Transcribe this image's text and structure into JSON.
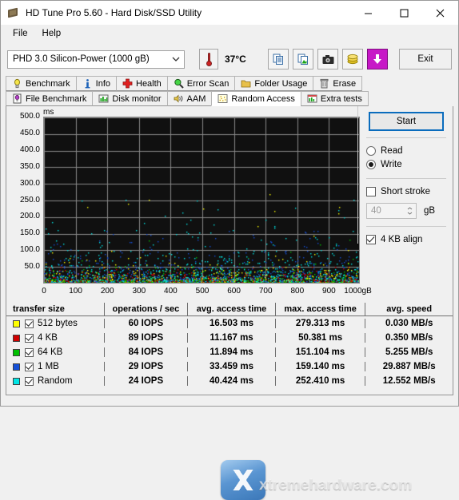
{
  "window": {
    "title": "HD Tune Pro 5.60 - Hard Disk/SSD Utility",
    "minimize_label": "Minimize",
    "maximize_label": "Maximize",
    "close_label": "Close"
  },
  "menu": {
    "items": [
      {
        "label": "File"
      },
      {
        "label": "Help"
      }
    ]
  },
  "toolbar": {
    "drive": "PHD 3.0 Silicon-Power (1000 gB)",
    "temperature": "37°C",
    "buttons": [
      {
        "name": "copy-button",
        "label": "Copy"
      },
      {
        "name": "copy-image-button",
        "label": "Copy image"
      },
      {
        "name": "screenshot-button",
        "label": "Screenshot"
      },
      {
        "name": "coins-button",
        "label": "Register"
      },
      {
        "name": "save-button",
        "label": "Save"
      }
    ],
    "exit_label": "Exit"
  },
  "tabs": {
    "row1": [
      {
        "label": "Benchmark",
        "icon": "lightbulb-icon",
        "active": false
      },
      {
        "label": "Info",
        "icon": "info-icon",
        "active": false
      },
      {
        "label": "Health",
        "icon": "health-cross-icon",
        "active": false
      },
      {
        "label": "Error Scan",
        "icon": "magnifier-icon",
        "active": false
      },
      {
        "label": "Folder Usage",
        "icon": "folder-icon",
        "active": false
      },
      {
        "label": "Erase",
        "icon": "trash-icon",
        "active": false
      }
    ],
    "row2": [
      {
        "label": "File Benchmark",
        "icon": "file-benchmark-icon",
        "active": false
      },
      {
        "label": "Disk monitor",
        "icon": "bar-chart-icon",
        "active": false
      },
      {
        "label": "AAM",
        "icon": "speaker-icon",
        "active": false
      },
      {
        "label": "Random Access",
        "icon": "scatter-icon",
        "active": true
      },
      {
        "label": "Extra tests",
        "icon": "grid-chart-icon",
        "active": false
      }
    ]
  },
  "panel": {
    "start_label": "Start",
    "mode_read_label": "Read",
    "mode_write_label": "Write",
    "mode_selected": "Write",
    "short_stroke_label": "Short stroke",
    "short_stroke_checked": false,
    "short_stroke_value": "40",
    "short_stroke_unit": "gB",
    "align_label": "4 KB align",
    "align_checked": true
  },
  "chart_data": {
    "type": "scatter",
    "title": "",
    "xlabel": "",
    "ylabel": "ms",
    "yunit": "ms",
    "xunit": "gB",
    "xlim": [
      0,
      1000
    ],
    "ylim": [
      0,
      500
    ],
    "ytick_labels": [
      "500.0",
      "450.0",
      "400.0",
      "350.0",
      "300.0",
      "250.0",
      "200.0",
      "150.0",
      "100.0",
      "50.0"
    ],
    "yticks": [
      500,
      450,
      400,
      350,
      300,
      250,
      200,
      150,
      100,
      50
    ],
    "xtick_labels": [
      "0",
      "100",
      "200",
      "300",
      "400",
      "500",
      "600",
      "700",
      "800",
      "900",
      "1000gB"
    ],
    "xticks": [
      0,
      100,
      200,
      300,
      400,
      500,
      600,
      700,
      800,
      900,
      1000
    ],
    "grid": true,
    "plot_bg": "#101010",
    "grid_color": "#8a8a8a",
    "series": [
      {
        "name": "512 bytes",
        "color": "#ffff00",
        "count": 620,
        "mean_ms": 16.503,
        "max_ms": 279.313
      },
      {
        "name": "4 KB",
        "color": "#d00000",
        "count": 620,
        "mean_ms": 11.167,
        "max_ms": 50.381
      },
      {
        "name": "64 KB",
        "color": "#00c000",
        "count": 620,
        "mean_ms": 11.894,
        "max_ms": 151.104
      },
      {
        "name": "1 MB",
        "color": "#1550d8",
        "count": 620,
        "mean_ms": 33.459,
        "max_ms": 159.14
      },
      {
        "name": "Random",
        "color": "#00e5e5",
        "count": 620,
        "mean_ms": 40.424,
        "max_ms": 252.41
      }
    ]
  },
  "results": {
    "headers": [
      "transfer size",
      "operations / sec",
      "avg. access time",
      "max. access time",
      "avg. speed"
    ],
    "rows": [
      {
        "color": "#ffff00",
        "checked": true,
        "name": "512 bytes",
        "ops": "60 IOPS",
        "avg": "16.503 ms",
        "max": "279.313 ms",
        "speed": "0.030 MB/s"
      },
      {
        "color": "#d00000",
        "checked": true,
        "name": "4 KB",
        "ops": "89 IOPS",
        "avg": "11.167 ms",
        "max": "50.381 ms",
        "speed": "0.350 MB/s"
      },
      {
        "color": "#00c000",
        "checked": true,
        "name": "64 KB",
        "ops": "84 IOPS",
        "avg": "11.894 ms",
        "max": "151.104 ms",
        "speed": "5.255 MB/s"
      },
      {
        "color": "#1550d8",
        "checked": true,
        "name": "1 MB",
        "ops": "29 IOPS",
        "avg": "33.459 ms",
        "max": "159.140 ms",
        "speed": "29.887 MB/s"
      },
      {
        "color": "#00e5e5",
        "checked": true,
        "name": "Random",
        "ops": "24 IOPS",
        "avg": "40.424 ms",
        "max": "252.410 ms",
        "speed": "12.552 MB/s"
      }
    ]
  },
  "watermark": {
    "text": "xtremehardware.com"
  }
}
